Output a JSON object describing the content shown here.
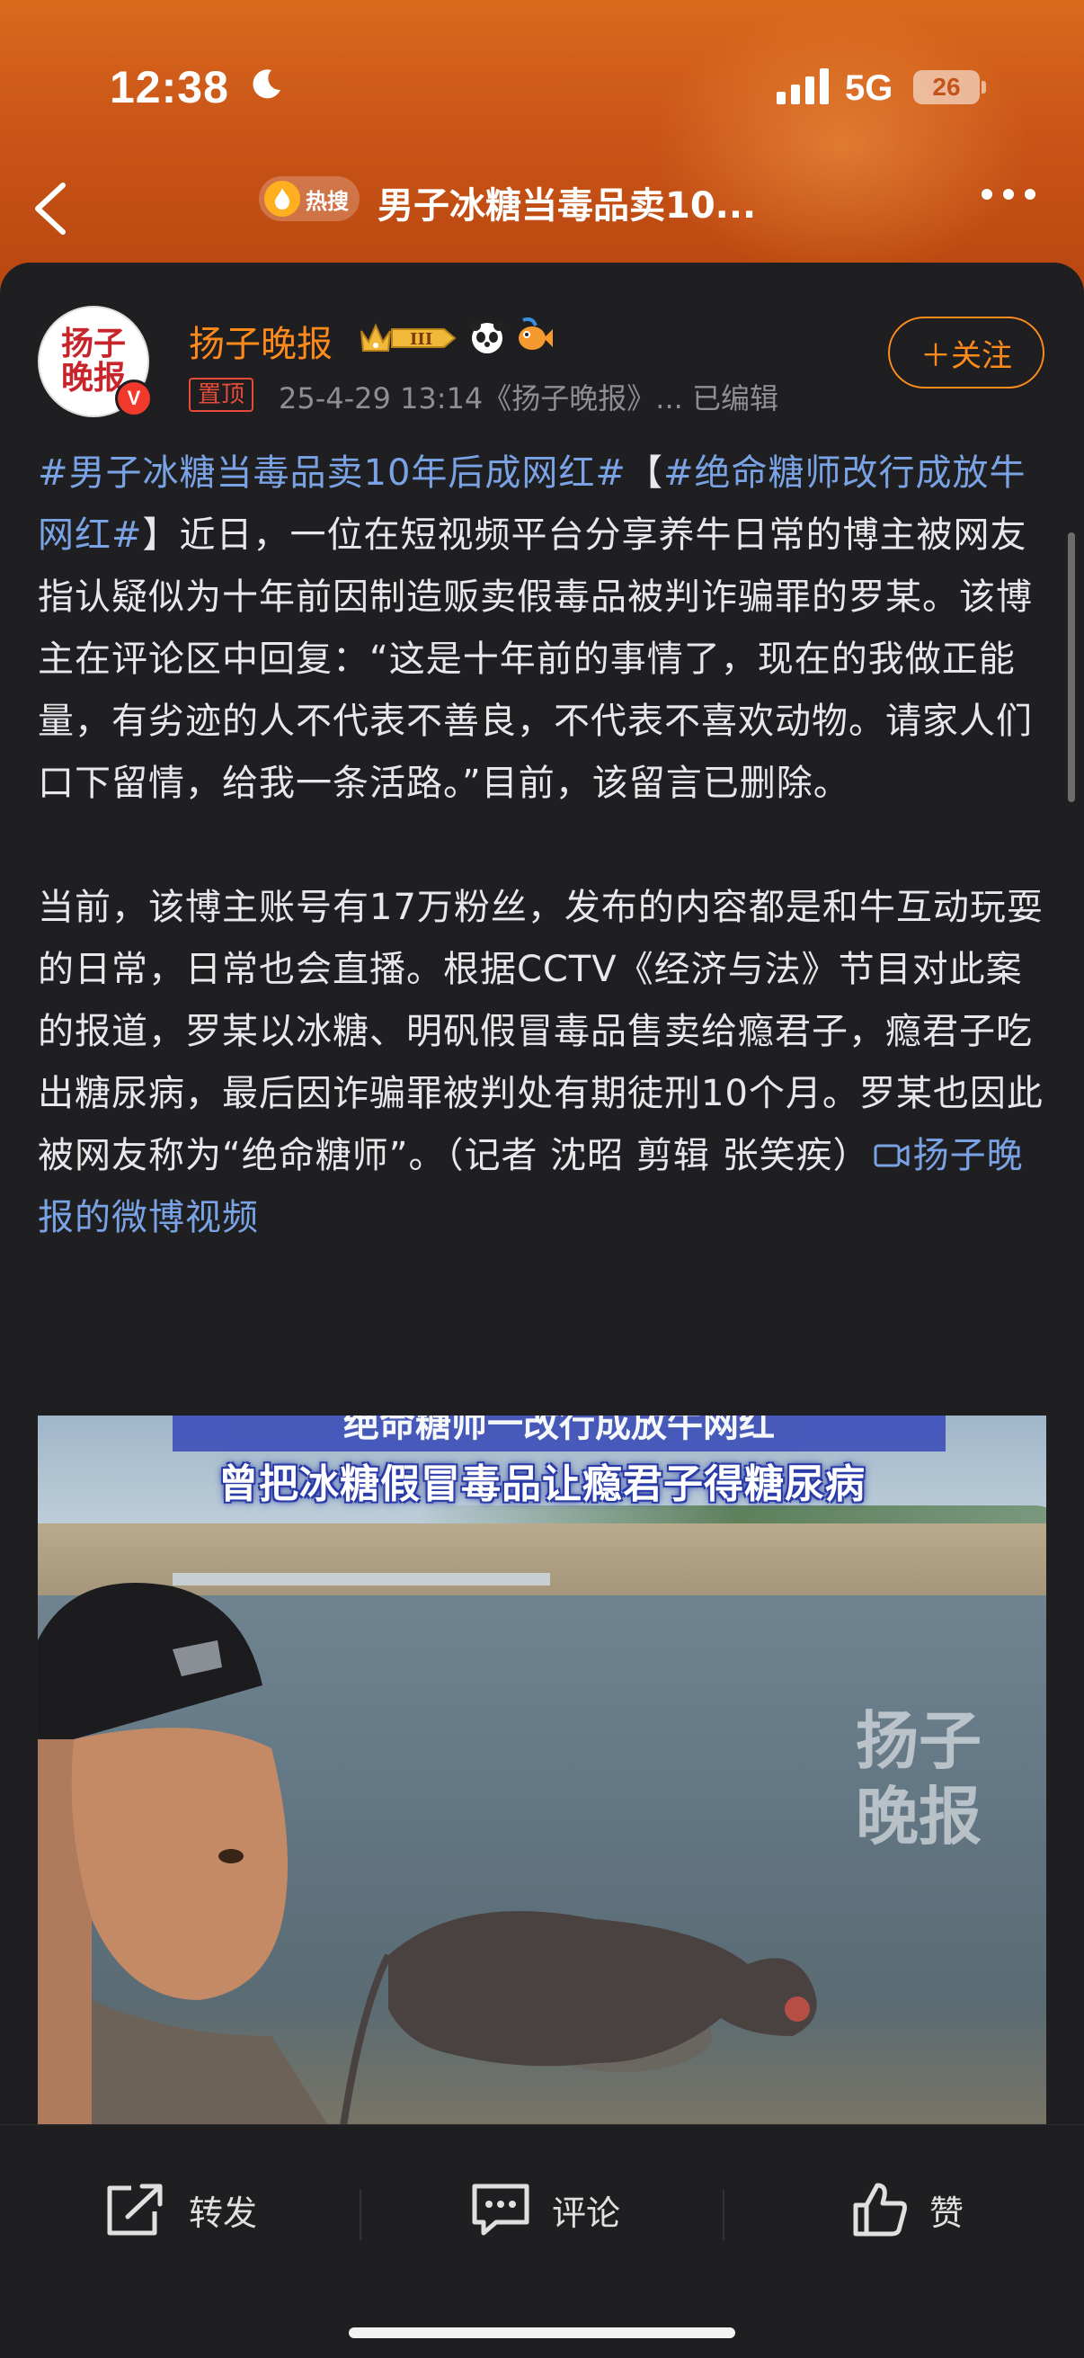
{
  "status_bar": {
    "time": "12:38",
    "network": "5G",
    "battery": "26"
  },
  "nav": {
    "hot_label": "热搜",
    "title": "男子冰糖当毒品卖10..."
  },
  "author": {
    "name": "扬子晚报",
    "avatar_text_line1": "扬子",
    "avatar_text_line2": "晚报",
    "verified_badge": "V",
    "vip_level": "III",
    "pinned_label": "置顶",
    "meta": "25-4-29 13:14《扬子晚报》...  已编辑",
    "follow_label": "＋关注"
  },
  "post": {
    "tag1": "#男子冰糖当毒品卖10年后成网红#",
    "bracket_open": "【",
    "tag2": "#绝命糖师改行成放牛网红#",
    "para1_rest": "】近日，一位在短视频平台分享养牛日常的博主被网友指认疑似为十年前因制造贩卖假毒品被判诈骗罪的罗某。该博主在评论区中回复：“这是十年前的事情了，现在的我做正能量，有劣迹的人不代表不善良，不代表不喜欢动物。请家人们口下留情，给我一条活路。”目前，该留言已删除。",
    "para2": "当前，该博主账号有17万粉丝，发布的内容都是和牛互动玩耍的日常，日常也会直播。根据CCTV《经济与法》节目对此案的报道，罗某以冰糖、明矾假冒毒品售卖给瘾君子，瘾君子吃出糖尿病，最后因诈骗罪被判处有期徒刑10个月。罗某也因此被网友称为“绝命糖师”。（记者 沈昭 剪辑 张笑疾）",
    "video_link": "扬子晚报的微博视频"
  },
  "video": {
    "caption_top": "绝命糖师一改行成放牛网红",
    "caption": "曾把冰糖假冒毒品让瘾君子得糖尿病",
    "watermark_line1": "扬子",
    "watermark_line2": "晚报"
  },
  "actions": {
    "repost": "转发",
    "comment": "评论",
    "like": "赞"
  },
  "colors": {
    "accent": "#ff8a1c",
    "link": "#7aa3e5",
    "header_bg": "#c95418",
    "card_bg": "#1f1f21"
  }
}
